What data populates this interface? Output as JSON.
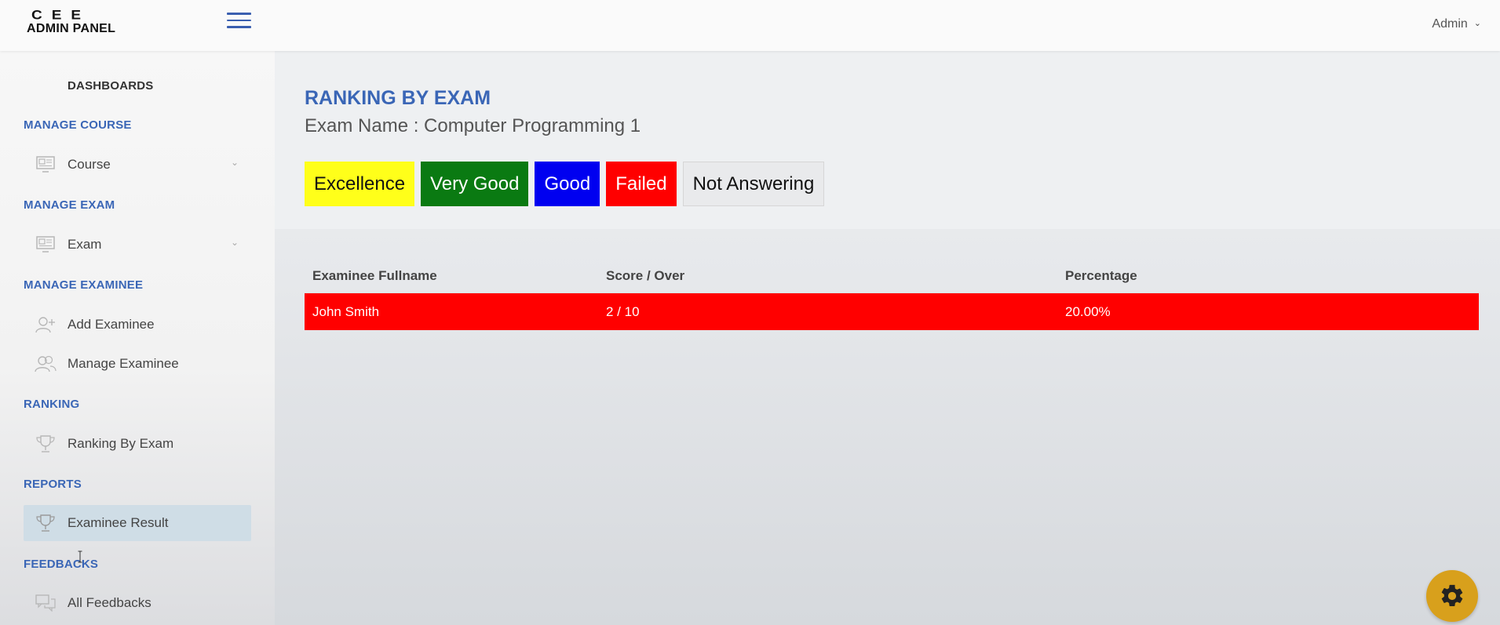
{
  "app": {
    "logo_line1": "CEE",
    "logo_line2": "ADMIN PANEL",
    "user_menu": "Admin"
  },
  "sidebar": {
    "dashboards": "DASHBOARDS",
    "sections": [
      {
        "heading": "MANAGE COURSE",
        "items": [
          {
            "label": "Course",
            "icon": "monitor-icon",
            "has_caret": true
          }
        ]
      },
      {
        "heading": "MANAGE EXAM",
        "items": [
          {
            "label": "Exam",
            "icon": "monitor-icon",
            "has_caret": true
          }
        ]
      },
      {
        "heading": "MANAGE EXAMINEE",
        "items": [
          {
            "label": "Add Examinee",
            "icon": "add-user-icon"
          },
          {
            "label": "Manage Examinee",
            "icon": "users-icon"
          }
        ]
      },
      {
        "heading": "RANKING",
        "items": [
          {
            "label": "Ranking By Exam",
            "icon": "trophy-icon"
          }
        ]
      },
      {
        "heading": "REPORTS",
        "items": [
          {
            "label": "Examinee Result",
            "icon": "trophy-icon",
            "active": true
          }
        ]
      },
      {
        "heading": "FEEDBACKS",
        "items": [
          {
            "label": "All Feedbacks",
            "icon": "chat-icon"
          }
        ]
      }
    ]
  },
  "main": {
    "title": "RANKING BY EXAM",
    "exam_name": "Exam Name : Computer Programming 1",
    "legend": [
      {
        "label": "Excellence",
        "color": "#ffff1a"
      },
      {
        "label": "Very Good",
        "color": "#0a7a12"
      },
      {
        "label": "Good",
        "color": "#0000f0"
      },
      {
        "label": "Failed",
        "color": "#ff0000"
      },
      {
        "label": "Not Answering",
        "color": "#e9eaec"
      }
    ],
    "table": {
      "columns": [
        "Examinee Fullname",
        "Score / Over",
        "Percentage"
      ],
      "rows": [
        {
          "fullname": "John Smith",
          "score": "2 / 10",
          "percentage": "20.00%",
          "status_color": "#ff0000"
        }
      ]
    }
  },
  "settings_icon": "gear-icon"
}
